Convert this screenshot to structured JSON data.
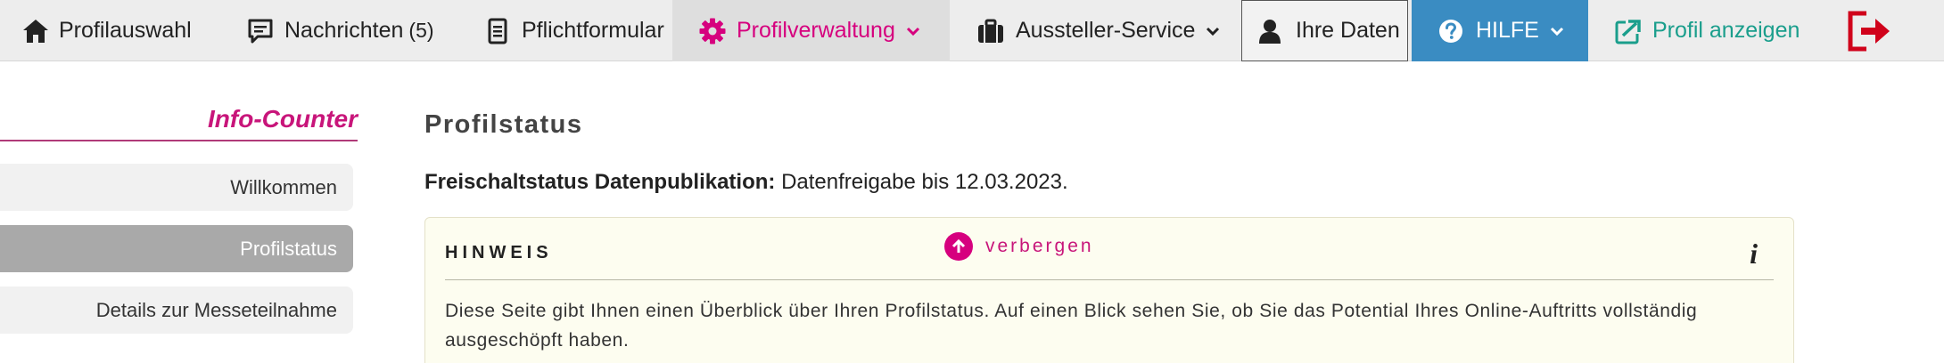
{
  "nav": {
    "home": "Profilauswahl",
    "messages": "Nachrichten",
    "messages_count": "(5)",
    "form": "Pflichtformular",
    "profile_admin": "Profilverwaltung",
    "exhibitor_service": "Aussteller-Service",
    "your_data": "Ihre Daten",
    "help": "HILFE",
    "show_profile": "Profil anzeigen"
  },
  "sidebar": {
    "title": "Info-Counter",
    "items": [
      {
        "label": "Willkommen"
      },
      {
        "label": "Profilstatus"
      },
      {
        "label": "Details zur Messeteilnahme"
      }
    ]
  },
  "main": {
    "title": "Profilstatus",
    "status_label": "Freischaltstatus Datenpublikation:",
    "status_value": "Datenfreigabe bis 12.03.2023.",
    "hint": {
      "label": "HINWEIS",
      "toggle": "verbergen",
      "info": "i",
      "text": "Diese Seite gibt Ihnen einen Überblick über Ihren Profilstatus. Auf einen Blick sehen Sie, ob Sie das Potential Ihres Online-Auftritts vollständig ausgeschöpft haben."
    }
  },
  "colors": {
    "accent": "#d6007e",
    "help_bg": "#3a8cc2",
    "teal": "#1a9e8c",
    "logout": "#d0021b"
  }
}
